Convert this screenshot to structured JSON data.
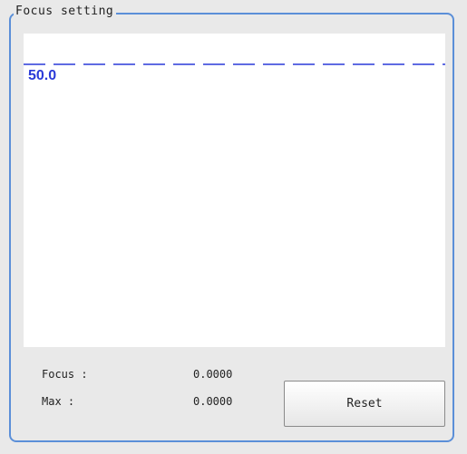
{
  "panel": {
    "title": "Focus setting"
  },
  "graph": {
    "scale_label": "50.0",
    "line_color": "#2a3ad8"
  },
  "readouts": [
    {
      "label": "Focus :",
      "value": "0.0000"
    },
    {
      "label": "Max :",
      "value": "0.0000"
    }
  ],
  "buttons": {
    "reset_label": "Reset"
  }
}
